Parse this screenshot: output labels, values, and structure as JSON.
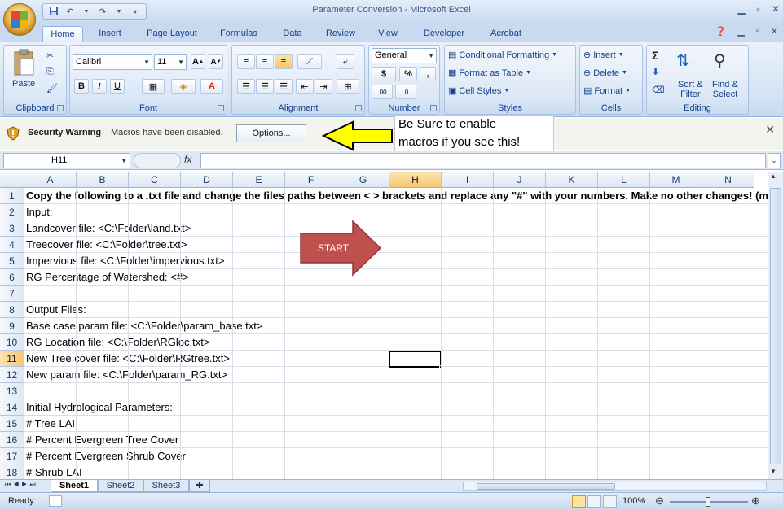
{
  "app": {
    "title": "Parameter Conversion - Microsoft Excel"
  },
  "ribbon": {
    "tabs": [
      "Home",
      "Insert",
      "Page Layout",
      "Formulas",
      "Data",
      "Review",
      "View",
      "Developer",
      "Acrobat"
    ],
    "active_tab": "Home",
    "clipboard": {
      "label": "Clipboard",
      "paste": "Paste"
    },
    "font": {
      "label": "Font",
      "family": "Calibri",
      "size": "11"
    },
    "alignment": {
      "label": "Alignment"
    },
    "number": {
      "label": "Number",
      "format": "General",
      "currency": "$",
      "percent": "%",
      "comma": ","
    },
    "styles": {
      "label": "Styles",
      "conditional": "Conditional Formatting",
      "table": "Format as Table",
      "cell_styles": "Cell Styles"
    },
    "cells": {
      "label": "Cells",
      "insert": "Insert",
      "delete": "Delete",
      "format": "Format"
    },
    "editing": {
      "label": "Editing",
      "sort": "Sort &",
      "sort2": "Filter",
      "find": "Find &",
      "find2": "Select"
    }
  },
  "security": {
    "title": "Security Warning",
    "message": "Macros have been disabled.",
    "options_label": "Options...",
    "note_line1": "Be Sure to enable",
    "note_line2": "macros if you see this!"
  },
  "formula_bar": {
    "name_box": "H11",
    "fx": "fx",
    "formula": ""
  },
  "grid": {
    "columns": [
      "A",
      "B",
      "C",
      "D",
      "E",
      "F",
      "G",
      "H",
      "I",
      "J",
      "K",
      "L",
      "M",
      "N"
    ],
    "selected_column": "H",
    "selected_row": "11",
    "rows": [
      {
        "n": "1",
        "text": "Copy the following to a .txt file and change the files paths between < > brackets and replace any \"#\" with your numbers.  Make no other changes! (m",
        "bold": true
      },
      {
        "n": "2",
        "text": "Input:"
      },
      {
        "n": "3",
        "text": "Landcover file: <C:\\Folder\\land.txt>"
      },
      {
        "n": "4",
        "text": "Treecover file: <C:\\Folder\\tree.txt>"
      },
      {
        "n": "5",
        "text": "Impervious file: <C:\\Folder\\impervious.txt>"
      },
      {
        "n": "6",
        "text": "RG Percentage of Watershed: <#>"
      },
      {
        "n": "7",
        "text": ""
      },
      {
        "n": "8",
        "text": "Output Files:"
      },
      {
        "n": "9",
        "text": "Base case param file: <C:\\Folder\\param_base.txt>"
      },
      {
        "n": "10",
        "text": "RG Location file: <C:\\Folder\\RGloc.txt>"
      },
      {
        "n": "11",
        "text": "New Tree cover file: <C:\\Folder\\RGtree.txt>"
      },
      {
        "n": "12",
        "text": "New param file: <C:\\Folder\\param_RG.txt>"
      },
      {
        "n": "13",
        "text": ""
      },
      {
        "n": "14",
        "text": "Initial Hydrological Parameters:"
      },
      {
        "n": "15",
        "text": "# Tree LAI"
      },
      {
        "n": "16",
        "text": "# Percent Evergreen Tree Cover"
      },
      {
        "n": "17",
        "text": "# Percent Evergreen Shrub Cover"
      },
      {
        "n": "18",
        "text": "# Shrub LAI"
      }
    ],
    "start_arrow": "START"
  },
  "sheets": {
    "tabs": [
      "Sheet1",
      "Sheet2",
      "Sheet3"
    ],
    "active": "Sheet1"
  },
  "status": {
    "text": "Ready",
    "zoom": "100%"
  },
  "colors": {
    "accent": "#15428b",
    "arrow_red": "#c0504d",
    "note_arrow": "#ffff00"
  }
}
